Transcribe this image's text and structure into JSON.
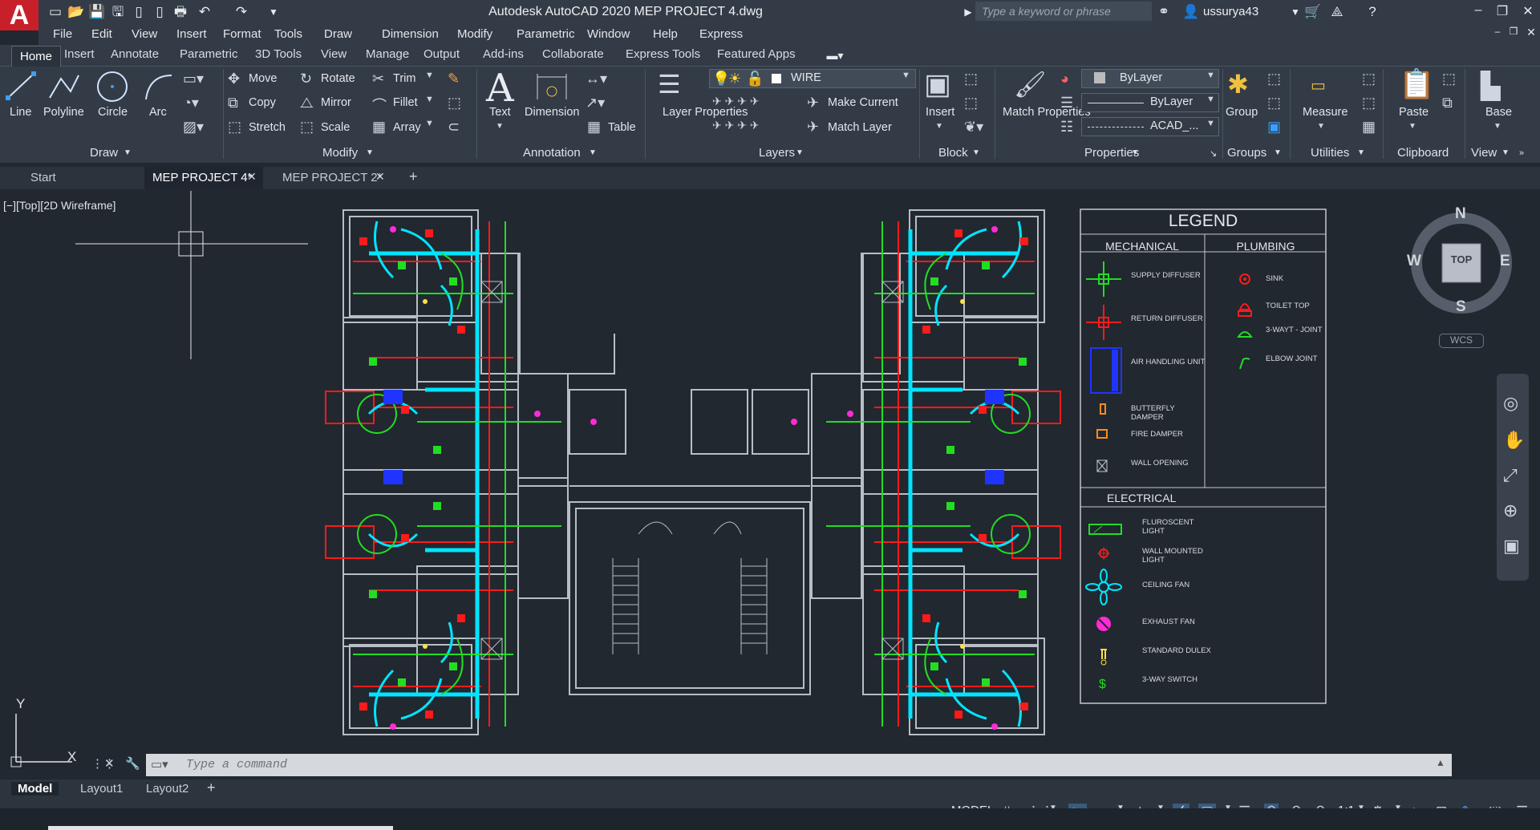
{
  "titlebar": {
    "app_title": "Autodesk AutoCAD 2020    MEP PROJECT 4.dwg",
    "search_placeholder": "Type a keyword or phrase",
    "username": "ussurya43",
    "logo_letter": "A"
  },
  "menu": [
    "File",
    "Edit",
    "View",
    "Insert",
    "Format",
    "Tools",
    "Draw",
    "Dimension",
    "Modify",
    "Parametric",
    "Window",
    "Help",
    "Express"
  ],
  "ribbon_tabs": [
    "Home",
    "Insert",
    "Annotate",
    "Parametric",
    "3D Tools",
    "View",
    "Manage",
    "Output",
    "Add-ins",
    "Collaborate",
    "Express Tools",
    "Featured Apps"
  ],
  "ribbon": {
    "draw": {
      "title": "Draw",
      "line": "Line",
      "polyline": "Polyline",
      "circle": "Circle",
      "arc": "Arc"
    },
    "modify": {
      "title": "Modify",
      "move": "Move",
      "rotate": "Rotate",
      "trim": "Trim",
      "copy": "Copy",
      "mirror": "Mirror",
      "fillet": "Fillet",
      "stretch": "Stretch",
      "scale": "Scale",
      "array": "Array"
    },
    "annotation": {
      "title": "Annotation",
      "text": "Text",
      "dimension": "Dimension",
      "table": "Table"
    },
    "layers": {
      "title": "Layers",
      "layer_properties": "Layer Properties",
      "current_layer": "WIRE",
      "make_current": "Make Current",
      "match_layer": "Match Layer"
    },
    "block": {
      "title": "Block",
      "insert": "Insert"
    },
    "properties": {
      "title": "Properties",
      "match_properties": "Match Properties",
      "color": "ByLayer",
      "lineweight": "ByLayer",
      "linetype": "ACAD_..."
    },
    "groups": {
      "title": "Groups",
      "group": "Group"
    },
    "utilities": {
      "title": "Utilities",
      "measure": "Measure"
    },
    "clipboard": {
      "title": "Clipboard",
      "paste": "Paste"
    },
    "view": {
      "title": "View",
      "base": "Base"
    }
  },
  "doc_tabs": [
    "Start",
    "MEP PROJECT 4*",
    "MEP PROJECT 2*"
  ],
  "viewport_label": "[−][Top][2D Wireframe]",
  "viewcube": {
    "top": "TOP",
    "n": "N",
    "s": "S",
    "e": "E",
    "w": "W",
    "wcs": "WCS"
  },
  "ucs": {
    "x": "X",
    "y": "Y"
  },
  "legend": {
    "title": "LEGEND",
    "mechanical": "MECHANICAL",
    "plumbing": "PLUMBING",
    "electrical": "ELECTRICAL",
    "mech_items": [
      "SUPPLY DIFFUSER",
      "RETURN DIFFUSER",
      "AIR HANDLING UNIT",
      "BUTTERFLY DAMPER",
      "FIRE DAMPER",
      "WALL OPENING"
    ],
    "plumb_items": [
      "SINK",
      "TOILET TOP",
      "3-WAYT - JOINT",
      "ELBOW JOINT"
    ],
    "elec_items": [
      "FLUROSCENT LIGHT",
      "WALL MOUNTED LIGHT",
      "CEILING FAN",
      "EXHAUST FAN",
      "STANDARD DULEX",
      "3-WAY SWITCH"
    ]
  },
  "command_placeholder": "Type a command",
  "layout_tabs": [
    "Model",
    "Layout1",
    "Layout2"
  ],
  "status": {
    "model": "MODEL",
    "scale": "1:1"
  },
  "colors": {
    "accent_red": "#c8202a",
    "cyan": "#00e5ff",
    "green": "#22dd22",
    "red": "#ff1a1a",
    "magenta": "#ff2bd6",
    "yellow": "#ffe14a",
    "blue": "#1f35ff"
  }
}
